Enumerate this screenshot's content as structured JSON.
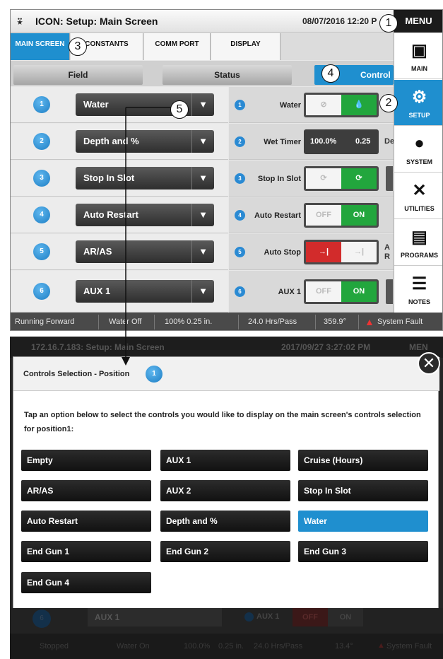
{
  "top": {
    "logo": "⍣",
    "title": "ICON: Setup: Main Screen",
    "datetime": "08/07/2016 12:20 P",
    "menu_label": "MENU",
    "tabs": [
      "MAIN SCREEN",
      "CONSTANTS",
      "COMM PORT",
      "DISPLAY"
    ],
    "subtabs": [
      "Field",
      "Status",
      "Control"
    ],
    "rows": [
      {
        "num": "1",
        "dropdown": "Water",
        "label": "Water"
      },
      {
        "num": "2",
        "dropdown": "Depth and %",
        "label": "Wet Timer"
      },
      {
        "num": "3",
        "dropdown": "Stop In Slot",
        "label": "Stop In Slot"
      },
      {
        "num": "4",
        "dropdown": "Auto Restart",
        "label": "Auto Restart"
      },
      {
        "num": "5",
        "dropdown": "AR/AS",
        "label": "Auto Stop"
      },
      {
        "num": "6",
        "dropdown": "AUX 1",
        "label": "AUX 1"
      }
    ],
    "wet_timer": {
      "percent": "100.0%",
      "depth": "0.25",
      "cut": "De"
    },
    "toggle_off": "OFF",
    "toggle_on": "ON",
    "auto_stop_cut": "A",
    "auto_stop_cut2": "R",
    "menu_items": [
      "MAIN",
      "SETUP",
      "SYSTEM",
      "UTILITIES",
      "PROGRAMS",
      "NOTES"
    ],
    "status": {
      "running": "Running Forward",
      "water": "Water Off",
      "percent": "100% 0.25 in.",
      "hrs": "24.0 Hrs/Pass",
      "angle": "359.9°",
      "fault": "System Fault"
    }
  },
  "callouts": [
    "1",
    "2",
    "3",
    "4",
    "5"
  ],
  "bottom": {
    "dim_header": "172.16.7.183: Setup: Main Screen",
    "dim_datetime": "2017/09/27 3:27:02 PM",
    "dim_menu": "MEN",
    "modal_title": "Controls Selection - Position",
    "modal_num": "1",
    "description": "Tap an option below to select the controls you would like to display on the main screen's controls selection for position1:",
    "options": [
      [
        "Empty",
        "AUX 1",
        "Cruise (Hours)"
      ],
      [
        "AR/AS",
        "AUX 2",
        "Stop In Slot"
      ],
      [
        "Auto Restart",
        "Depth and %",
        "Water"
      ],
      [
        "End Gun 1",
        "End Gun 2",
        "End Gun 3"
      ],
      [
        "End Gun 4"
      ]
    ],
    "selected": "Water",
    "close_icon": "✕",
    "dim_row": {
      "num": "6",
      "dropdown": "AUX 1",
      "label": "AUX 1",
      "off": "OFF",
      "on": "ON"
    },
    "dim_status": {
      "running": "Stopped",
      "water": "Water On",
      "percent": "100.0%",
      "depth": "0.25 in.",
      "hrs": "24.0 Hrs/Pass",
      "angle": "13.4°",
      "fault": "System Fault"
    }
  }
}
